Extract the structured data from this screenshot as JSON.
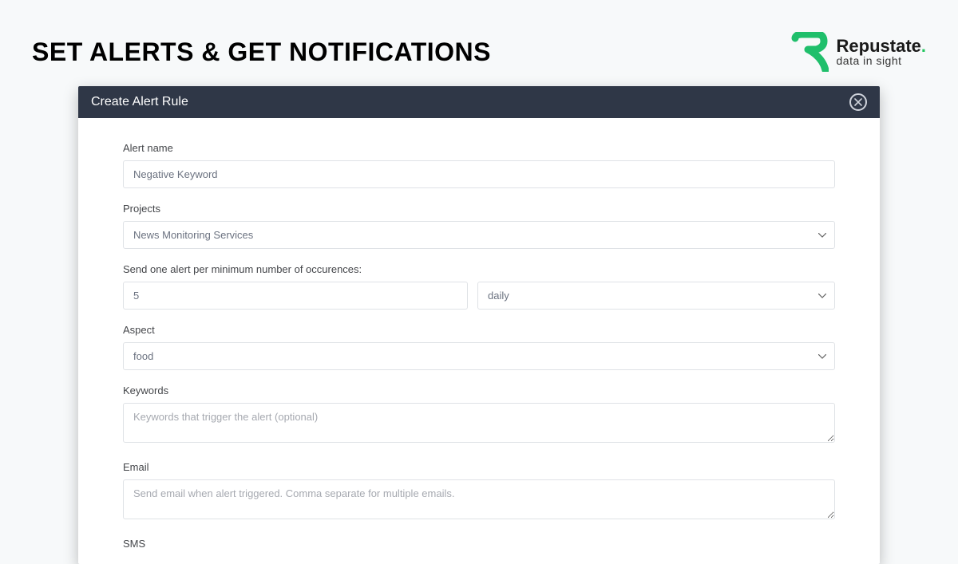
{
  "page": {
    "title": "SET ALERTS & GET NOTIFICATIONS"
  },
  "brand": {
    "name": "Repustate",
    "tagline": "data in sight"
  },
  "modal": {
    "title": "Create Alert Rule",
    "fields": {
      "alert_name": {
        "label": "Alert name",
        "value": "Negative Keyword"
      },
      "projects": {
        "label": "Projects",
        "selected": "News Monitoring Services"
      },
      "occurrences": {
        "label": "Send one alert per minimum number of occurences:",
        "value": "5",
        "frequency": "daily"
      },
      "aspect": {
        "label": "Aspect",
        "selected": "food"
      },
      "keywords": {
        "label": "Keywords",
        "placeholder": "Keywords that trigger the alert (optional)"
      },
      "email": {
        "label": "Email",
        "placeholder": "Send email when alert triggered. Comma separate for multiple emails."
      },
      "sms": {
        "label": "SMS"
      }
    }
  }
}
